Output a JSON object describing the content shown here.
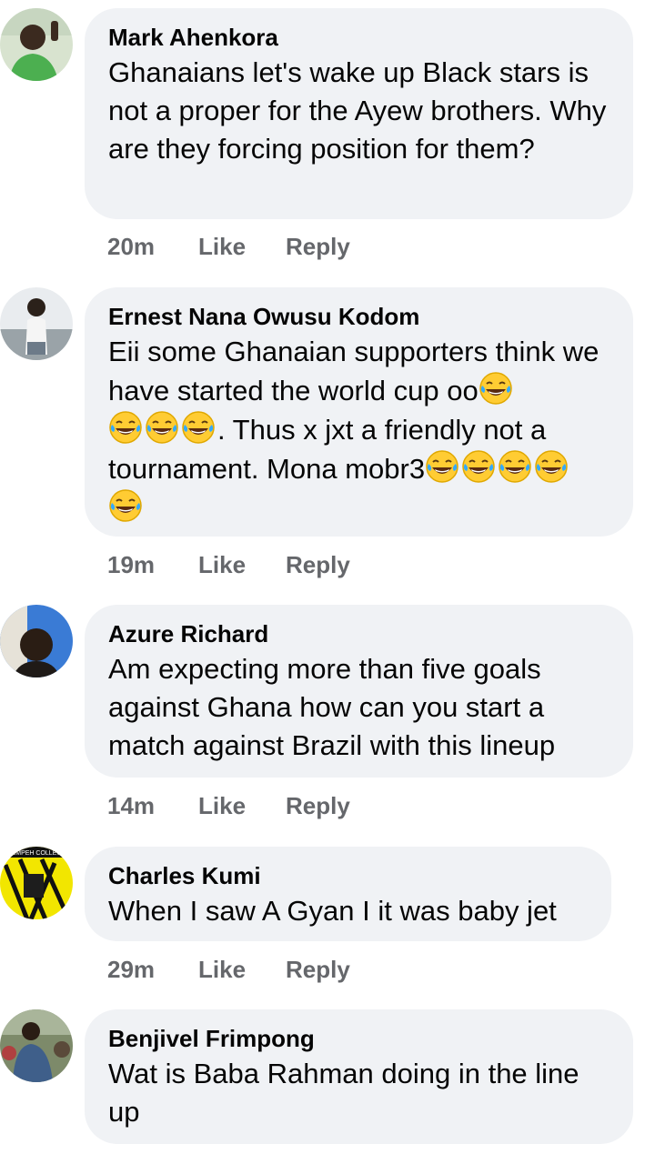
{
  "comments": [
    {
      "author": "Mark Ahenkora",
      "text": "Ghanaians let's wake up Black stars is not a proper for the Ayew brothers. Why are they forcing position for them?",
      "time": "20m",
      "like": "Like",
      "reply": "Reply"
    },
    {
      "author": "Ernest Nana Owusu Kodom",
      "text_parts": [
        "Eii some Ghanaian supporters think we have started the world cup oo",
        ". Thus x jxt a friendly not a tournament. Mona mobr3"
      ],
      "emoji": "face-with-tears-of-joy",
      "time": "19m",
      "like": "Like",
      "reply": "Reply"
    },
    {
      "author": "Azure Richard",
      "text": "Am expecting more than five goals against Ghana how can you start a match against Brazil with this lineup",
      "time": "14m",
      "like": "Like",
      "reply": "Reply"
    },
    {
      "author": "Charles Kumi",
      "text": "When I saw A Gyan I it was baby jet",
      "avatar_text": "HEMPEH COLLEGE",
      "time": "29m",
      "like": "Like",
      "reply": "Reply"
    },
    {
      "author": "Benjivel Frimpong",
      "text": "Wat is Baba Rahman doing in the line up"
    }
  ],
  "colors": {
    "bubble": "#f0f2f5",
    "meta_text": "#65676b",
    "emoji_face": "#ffcc33",
    "emoji_tear": "#33aaff"
  }
}
